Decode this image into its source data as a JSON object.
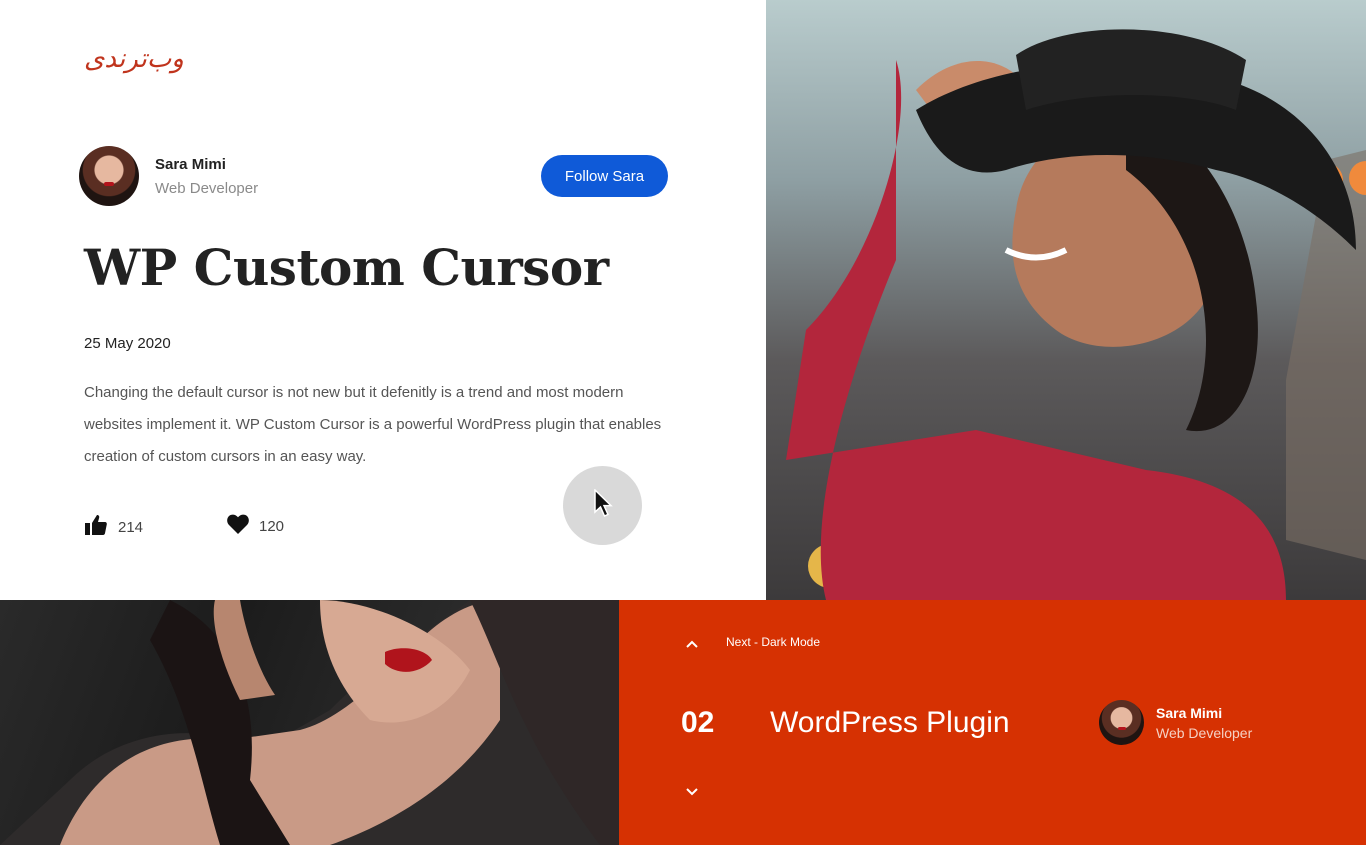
{
  "logo": {
    "text": "وب‌ترندی"
  },
  "author": {
    "name": "Sara Mimi",
    "role": "Web Developer",
    "follow_label": "Follow Sara"
  },
  "article": {
    "title": "WP Custom Cursor",
    "date": "25 May 2020",
    "description": "Changing the default cursor is not new but it defenitly is a trend and most modern websites implement it. WP Custom Cursor is a powerful WordPress plugin that enables creation of custom cursors in an easy way.",
    "likes": "214",
    "loves": "120"
  },
  "next": {
    "label": "Next - Dark Mode",
    "number": "02",
    "title": "WordPress Plugin",
    "author_name": "Sara Mimi",
    "author_role": "Web Developer"
  },
  "colors": {
    "accent": "#d63102",
    "button": "#0f5ad8",
    "logo": "#c0341d"
  },
  "icons": [
    "thumbs-up-icon",
    "heart-icon",
    "cursor-arrow-icon",
    "chevron-up-icon",
    "chevron-down-icon"
  ]
}
